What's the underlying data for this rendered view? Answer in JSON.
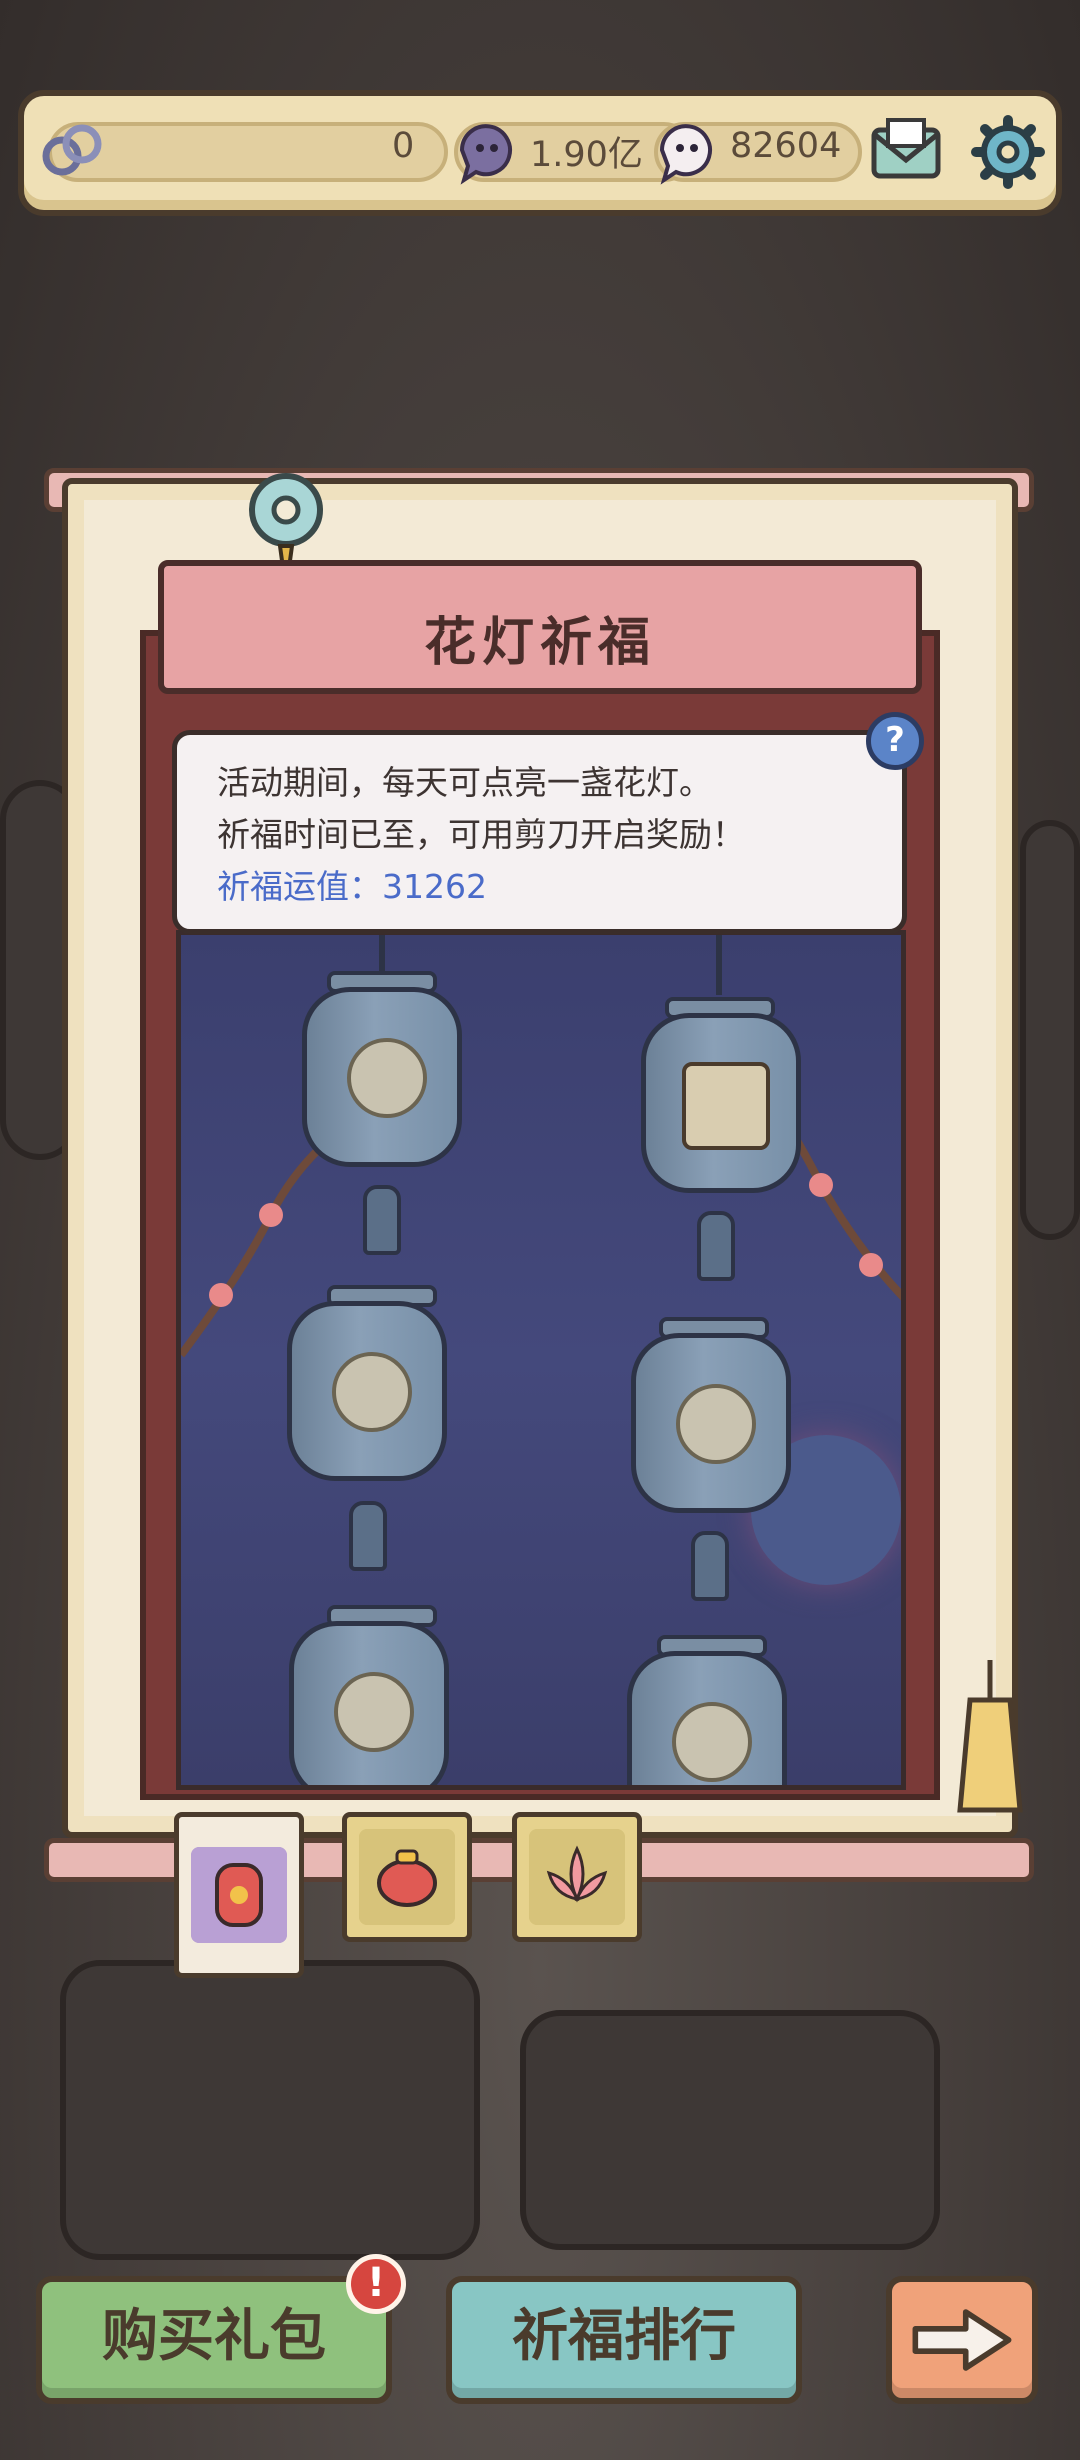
{
  "top_bar": {
    "resource1_value": "0",
    "resource2_value": "1.90亿",
    "resource3_value": "82604",
    "icons": [
      "knot-icon",
      "coin-bubble-icon",
      "spirit-bubble-icon",
      "mail-icon",
      "gear-icon"
    ]
  },
  "panel": {
    "title": "花灯祈福",
    "info_line1": "活动期间，每天可点亮一盏花灯。",
    "info_line2": "祈福时间已至，可用剪刀开启奖励！",
    "fortune_label": "祈福运值：",
    "fortune_value": "31262",
    "help_label": "?"
  },
  "lanterns": [
    {
      "column": "left",
      "emblem": "gift-basket-icon"
    },
    {
      "column": "left",
      "emblem": "scroll-emblem-icon"
    },
    {
      "column": "left",
      "emblem": "scroll-emblem-icon"
    },
    {
      "column": "right",
      "emblem": "snail-portrait-icon"
    },
    {
      "column": "right",
      "emblem": "clover-emblem-icon"
    },
    {
      "column": "right",
      "emblem": "clover-emblem-icon"
    }
  ],
  "tabs": [
    {
      "icon": "lantern-icon",
      "active": true
    },
    {
      "icon": "teapot-icon",
      "active": false
    },
    {
      "icon": "lotus-icon",
      "active": false
    }
  ],
  "buttons": {
    "buy_gift": "购买礼包",
    "ranking": "祈福排行",
    "alert_mark": "!"
  },
  "colors": {
    "buy_gift_bg": "#8fc17d",
    "ranking_bg": "#88c6c4",
    "next_bg": "#f0a27a",
    "fortune_text": "#4a6bc9"
  }
}
